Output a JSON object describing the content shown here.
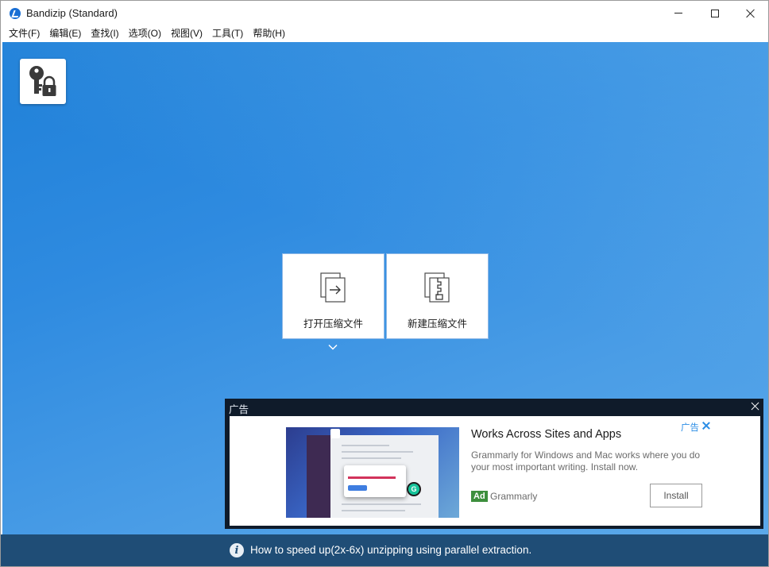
{
  "window": {
    "title": "Bandizip (Standard)",
    "icon": "bandizip-logo-icon"
  },
  "menu": {
    "items": [
      {
        "label": "文件(F)"
      },
      {
        "label": "编辑(E)"
      },
      {
        "label": "查找(I)"
      },
      {
        "label": "选项(O)"
      },
      {
        "label": "视图(V)"
      },
      {
        "label": "工具(T)"
      },
      {
        "label": "帮助(H)"
      }
    ]
  },
  "main": {
    "password_tile_icon": "key-lock-icon",
    "open_archive_label": "打开压缩文件",
    "new_archive_label": "新建压缩文件",
    "open_icon": "open-archive-icon",
    "new_icon": "new-archive-icon",
    "background_color": "#2f8be0"
  },
  "ad": {
    "header_label": "广告",
    "title": "Works Across Sites and Apps",
    "description": "Grammarly for Windows and Mac works where you do your most important writing. Install now.",
    "badge": "Ad",
    "advertiser": "Grammarly",
    "install_label": "Install",
    "choices_label": "广告",
    "accent_color": "#2c8ee6"
  },
  "tip": {
    "text": "How to speed up(2x-6x) unzipping using parallel extraction.",
    "icon": "info-icon",
    "bar_color": "#1f4d76"
  }
}
